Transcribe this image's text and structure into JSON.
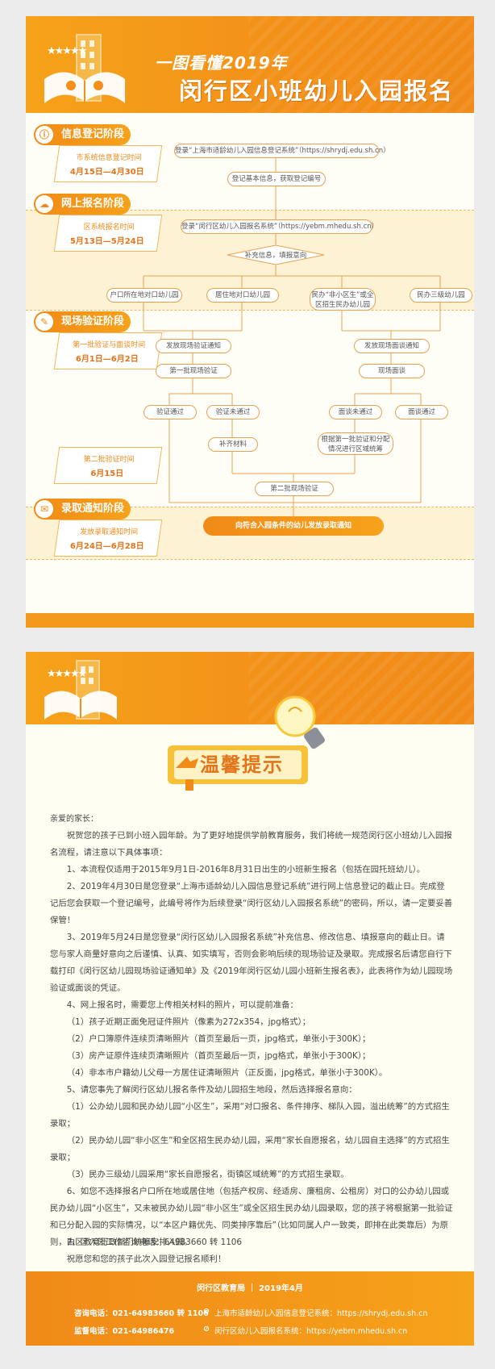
{
  "flow_card": {
    "title_line1": "一图看懂2019年",
    "title_line2": "闵行区小班幼儿入园报名流程",
    "stages": [
      {
        "icon": "info-icon",
        "label": "信息登记阶段",
        "note_label": "市系统信息登记时间",
        "note_date": "4月15日—4月30日"
      },
      {
        "icon": "online-icon",
        "label": "网上报名阶段",
        "note_label": "区系统报名时间",
        "note_date": "5月13日—5月24日"
      },
      {
        "icon": "onsite-icon",
        "label": "现场验证阶段",
        "note_label": "第一批验证与面谈时间",
        "note_date": "6月1日—6月2日"
      },
      {
        "icon": "calendar-icon",
        "label": "",
        "note_label": "第二批验证时间",
        "note_date": "6月15日"
      },
      {
        "icon": "notice-icon",
        "label": "录取通知阶段",
        "note_label": "发放录取通知时间",
        "note_date": "6月24日—6月28日"
      }
    ],
    "nodes": {
      "n1": "登录“上海市适龄幼儿入园信息登记系统”（https://shrydj.edu.sh.cn）",
      "n2": "登记基本信息，获取登记编号",
      "n3": "登录“闵行区幼儿入园报名系统”（https://yebm.mhedu.sh.cn）",
      "n4": "补充信息，填报意向",
      "n5a": "户口所在地对口幼儿园",
      "n5b": "居住地对口幼儿园",
      "n5c": "民办“非小区生”或全区招生民办幼儿园",
      "n5d": "民办三级幼儿园",
      "n6a": "发放现场验证通知",
      "n6b": "发放现场面谈通知",
      "n7a": "第一批现场验证",
      "n7b": "现场面谈",
      "n8a": "验证通过",
      "n8b": "验证未通过",
      "n8c": "面谈未通过",
      "n8d": "面谈通过",
      "n9a": "补齐材料",
      "n9b": "根据第一批验证和分配情况进行区域统筹",
      "n10": "第二批现场验证",
      "n11": "向符合入园条件的幼儿发放录取通知"
    }
  },
  "tips_card": {
    "sign": "温馨提示",
    "greeting": "亲爱的家长：",
    "paragraphs": [
      "祝贺您的孩子已到小班入园年龄。为了更好地提供学前教育服务，我们将统一规范闵行区小班幼儿入园报名流程，请注意以下具体事项：",
      "1、本流程仅适用于2015年9月1日-2016年8月31日出生的小班新生报名（包括在园托班幼儿）。",
      "2、2019年4月30日是您登录“上海市适龄幼儿入园信息登记系统”进行网上信息登记的截止日。完成登记后您会获取一个登记编号，此编号将作为后续登录“闵行区幼儿入园报名系统”的密码，所以，请一定要妥善保管！",
      "3、2019年5月24日是您登录“闵行区幼儿入园报名系统”补充信息、修改信息、填报意向的截止日。请您与家人商量好意向之后谨慎、认真、如实填写，否则会影响后续的现场验证及录取。完成报名后请您自行下载打印《闵行区幼儿园现场验证通知单》及《2019年闵行区幼儿园小班新生报名表》，此表将作为幼儿园现场验证或面谈的凭证。",
      "4、网上报名时，需要您上传相关材料的照片，可以提前准备：",
      "（1）孩子近期正面免冠证件照片（像素为272x354，jpg格式）；",
      "（2）户口簿原件连续页清晰照片（首页至最后一页，jpg格式，单张小于300K）；",
      "（3）房产证原件连续页清晰照片（首页至最后一页，jpg格式，单张小于300K）；",
      "（4）非本市户籍幼儿父母一方居住证清晰照片（正反面，jpg格式，单张小于300K）。",
      "5、请您事先了解闵行区幼儿报名条件及幼儿园招生地段，然后选择报名意向：",
      "（1）公办幼儿园和民办幼儿园“小区生”，采用“对口报名、条件排序、梯队入园，溢出统筹”的方式招生录取；",
      "（2）民办幼儿园“非小区生”和全区招生民办幼儿园，采用“家长自愿报名，幼儿园自主选择”的方式招生录取；",
      "（3）民办三级幼儿园采用“家长自愿报名，街镇区域统筹”的方式招生录取。",
      "6、如您不选择报名户口所在地或居住地（包括产权房、经适房、廉租房、公租房）对口的公办幼儿园或民办幼儿园“小区生”，又未被民办幼儿园“非小区生”或全区招生民办幼儿园录取，您的孩子将根据第一批验证和已分配入园的实际情况，以“本区户籍优先、同类排序靠后”（比如同属人户一致类，即排在此类靠后）为原则，由区教育行政部门统筹安排入园。",
      "7、区入园工作咨询电话：64983660 转 1106",
      "祝愿您和您的孩子此次入园登记报名顺利！"
    ],
    "footer": {
      "org": "闵行区教育局 ｜ 2019年4月",
      "consult": "咨询电话：021-64983660 转 1106",
      "supervise": "监督电话：021-64986476",
      "site1": "上海市适龄幼儿入园信息登记系统：https://shrydj.edu.sh.cn",
      "site2": "闵行区幼儿入园报名系统：https://yebm.mhedu.sh.cn"
    }
  }
}
